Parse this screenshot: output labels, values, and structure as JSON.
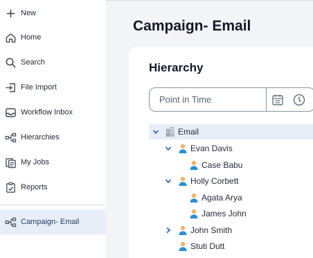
{
  "sidebar": {
    "items": [
      {
        "label": "New",
        "icon": "plus-icon"
      },
      {
        "label": "Home",
        "icon": "home-icon"
      },
      {
        "label": "Search",
        "icon": "search-icon"
      },
      {
        "label": "File Import",
        "icon": "file-import-icon"
      },
      {
        "label": "Workflow Inbox",
        "icon": "inbox-icon"
      },
      {
        "label": "Hierarchies",
        "icon": "hierarchy-icon"
      },
      {
        "label": "My Jobs",
        "icon": "jobs-icon"
      },
      {
        "label": "Reports",
        "icon": "reports-icon"
      }
    ],
    "active_item": {
      "label": "Campaign- Email",
      "icon": "hierarchy-icon"
    }
  },
  "page": {
    "title": "Campaign- Email"
  },
  "hierarchy": {
    "title": "Hierarchy",
    "point_in_time": {
      "placeholder": "Point in Time"
    },
    "tree": [
      {
        "label": "Email",
        "type": "building",
        "expanded": true,
        "selected": true
      },
      {
        "label": "Evan Davis",
        "type": "person",
        "expanded": true
      },
      {
        "label": "Case Babu",
        "type": "person"
      },
      {
        "label": "Holly Corbett",
        "type": "person",
        "expanded": true
      },
      {
        "label": "Agata Arya",
        "type": "person"
      },
      {
        "label": "James John",
        "type": "person"
      },
      {
        "label": "John Smith",
        "type": "person",
        "expanded": false
      },
      {
        "label": "Stuti Dutt",
        "type": "person"
      }
    ]
  },
  "colors": {
    "accent": "#1f3a60",
    "chevron": "#2a5da8",
    "person_head": "#f2b46a",
    "person_body": "#2b8fd6"
  }
}
